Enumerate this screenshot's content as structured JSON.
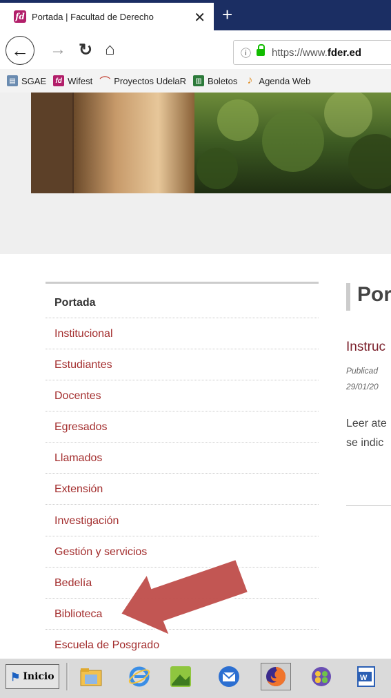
{
  "browser": {
    "tab_title": "Portada | Facultad de Derecho",
    "tab_favicon": "fd",
    "tab_close": "✕",
    "new_tab": "+",
    "url_prefix": "https://www.",
    "url_domain": "fder.ed",
    "bookmarks": [
      {
        "label": "SGAE",
        "icon": "sgae-icon"
      },
      {
        "label": "Wifest",
        "icon": "fd-icon"
      },
      {
        "label": "Proyectos UdelaR",
        "icon": "udelar-icon"
      },
      {
        "label": "Boletos",
        "icon": "boletos-icon"
      },
      {
        "label": "Agenda Web",
        "icon": "agenda-icon"
      }
    ]
  },
  "sidebar": {
    "items": [
      {
        "label": "Portada",
        "active": true
      },
      {
        "label": "Institucional"
      },
      {
        "label": "Estudiantes"
      },
      {
        "label": "Docentes"
      },
      {
        "label": "Egresados"
      },
      {
        "label": "Llamados"
      },
      {
        "label": "Extensión"
      },
      {
        "label": "Investigación"
      },
      {
        "label": "Gestión y servicios"
      },
      {
        "label": "Bedelía"
      },
      {
        "label": "Biblioteca"
      },
      {
        "label": "Escuela de Posgrado"
      }
    ]
  },
  "main": {
    "page_title": "Por",
    "article_title": "Instruc",
    "meta_line1": "Publicad",
    "meta_line2": "29/01/20",
    "body_line1": "Leer ate",
    "body_line2": "se indic"
  },
  "taskbar": {
    "start_label": "Inicio",
    "icons": [
      "file-explorer-icon",
      "internet-explorer-icon",
      "app-icon",
      "thunderbird-icon",
      "firefox-icon",
      "users-icon",
      "word-icon"
    ]
  },
  "colors": {
    "link": "#a32d2d",
    "arrow": "#c0504d",
    "tabbar": "#1b2e63"
  }
}
